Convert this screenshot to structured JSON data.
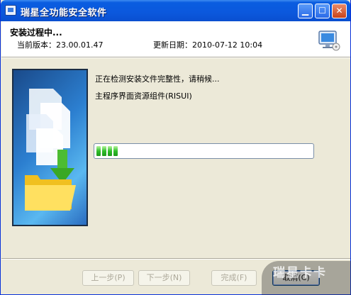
{
  "window": {
    "title": "瑞星全功能安全软件"
  },
  "header": {
    "title": "安装过程中...",
    "version_label": "当前版本：23.00.01.47",
    "date_label": "更新日期：2010-07-12 10:04"
  },
  "status": {
    "line1": "正在检测安装文件完整性，请稍候...",
    "line2": "主程序界面资源组件(RISUI)"
  },
  "progress": {
    "fraction": 0.11
  },
  "buttons": {
    "back": "上一步(P)",
    "next": "下一步(N)",
    "finish": "完成(F)",
    "cancel": "取消(C)"
  },
  "colors": {
    "title_bar": "#0a5de0",
    "progress_fill": "#2fbf2a"
  },
  "icons": [
    "app-icon",
    "minimize-icon",
    "maximize-icon",
    "close-icon",
    "monitor-icon",
    "document-icon",
    "arrow-down-icon",
    "folder-icon"
  ],
  "watermark": "瑞星卡卡"
}
